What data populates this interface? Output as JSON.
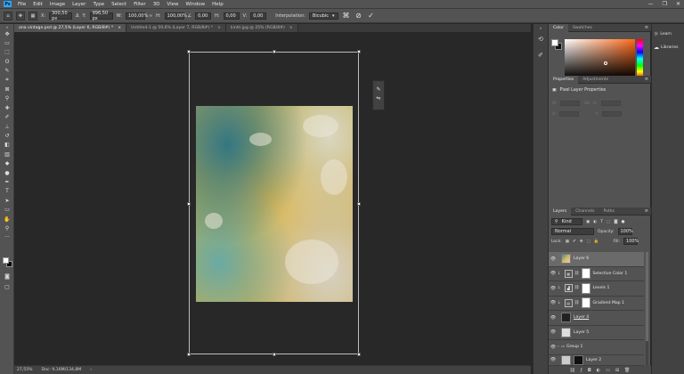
{
  "menu": {
    "logo": "Ps",
    "items": [
      "File",
      "Edit",
      "Image",
      "Layer",
      "Type",
      "Select",
      "Filter",
      "3D",
      "View",
      "Window",
      "Help"
    ],
    "window_controls": [
      "—",
      "❐",
      "✕"
    ]
  },
  "options": {
    "x_label": "X:",
    "x_value": "300,50 px",
    "y_label": "Y:",
    "y_value": "996,50 px",
    "w_label": "W:",
    "w_value": "100,00%",
    "h_label": "H:",
    "h_value": "100,00%",
    "angle_value": "0,00",
    "hskew_label": "H:",
    "hskew_value": "0,00",
    "vskew_label": "V:",
    "vskew_value": "0,00",
    "interp_label": "Interpolation:",
    "interp_value": "Bicubic"
  },
  "tabs": [
    {
      "label": "ana vintage.psd @ 27,5% (Layer 6, RGB/8#) *",
      "close": "×"
    },
    {
      "label": "Untitled-1 @ 59,6% (Layer 7, RGB/8#) *",
      "close": "×"
    },
    {
      "label": "kinkt.jpg @ 25% (RGB/8#)",
      "close": "×"
    }
  ],
  "status": {
    "zoom": "27,55%",
    "doc": "Doc: 9,16M/134,8M"
  },
  "color_panel": {
    "tabs": [
      "Color",
      "Swatches"
    ]
  },
  "properties_panel": {
    "tabs": [
      "Properties",
      "Adjustments"
    ],
    "title": "Pixel Layer Properties",
    "row1": {
      "w_label": "W:",
      "h_label": "H:",
      "link": "GO"
    },
    "row2": {
      "x_label": "X:",
      "y_label": "Y:"
    }
  },
  "layers_panel": {
    "tabs": [
      "Layers",
      "Channels",
      "Paths"
    ],
    "filter": "Kind",
    "blend_mode": "Normal",
    "opacity_label": "Opacity:",
    "opacity_value": "100%",
    "lock_label": "Lock:",
    "fill_label": "Fill:",
    "fill_value": "100%",
    "layers": [
      {
        "name": "Layer 6",
        "selected": true,
        "kind": "pixel"
      },
      {
        "name": "Selective Color 1",
        "selected": false,
        "kind": "adjustment",
        "adj_icon": "▦"
      },
      {
        "name": "Levels 1",
        "selected": false,
        "kind": "adjustment",
        "adj_icon": "▟"
      },
      {
        "name": "Gradient Map 1",
        "selected": false,
        "kind": "adjustment",
        "adj_icon": "▤"
      },
      {
        "name": "Layer 4",
        "selected": false,
        "kind": "pixel-dark"
      },
      {
        "name": "Layer 5",
        "selected": false,
        "kind": "pixel-light"
      },
      {
        "name": "Group 1",
        "selected": false,
        "kind": "group"
      },
      {
        "name": "Layer 2",
        "selected": false,
        "kind": "pixel-mask"
      }
    ]
  },
  "side_tabs": [
    {
      "label": "Learn",
      "icon": "lightbulb-icon"
    },
    {
      "label": "Libraries",
      "icon": "cloud-icon"
    }
  ]
}
